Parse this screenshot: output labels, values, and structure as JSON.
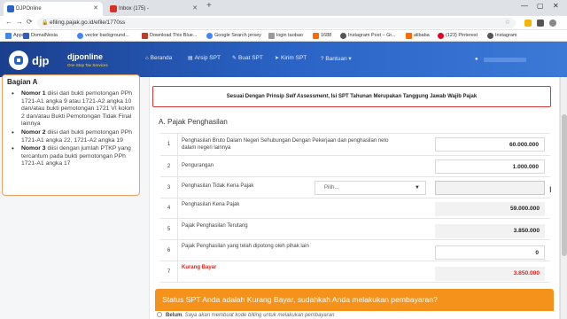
{
  "browser": {
    "tabs": [
      {
        "title": "DJPOnline",
        "active": true,
        "icon": "djp-favicon"
      },
      {
        "title": "Inbox (175) -",
        "active": false,
        "icon": "gmail-icon"
      }
    ],
    "url": "efiling.pajak.go.id/efile/1770ss",
    "bookmarks": [
      {
        "label": "Apps",
        "icon": "apps-icon",
        "color": "#4285f4"
      },
      {
        "label": "DomaiNesia",
        "icon": "domainesia-icon",
        "color": "#2f5fb8"
      },
      {
        "label": "vector background...",
        "icon": "google-icon",
        "color": "#4285f4"
      },
      {
        "label": "Download This Blue...",
        "icon": "page-icon",
        "color": "#c0392b"
      },
      {
        "label": "Google Search jersey",
        "icon": "google-icon",
        "color": "#4285f4"
      },
      {
        "label": "login taobao",
        "icon": "taobao-icon",
        "color": "#999999"
      },
      {
        "label": "1688",
        "icon": "1688-icon",
        "color": "#ff6a00"
      },
      {
        "label": "Instagram Post – Gr...",
        "icon": "instagram-icon",
        "color": "#555555"
      },
      {
        "label": "alibaba",
        "icon": "alibaba-icon",
        "color": "#ff6a00"
      },
      {
        "label": "(123) Pinterest",
        "icon": "pinterest-icon",
        "color": "#e60023"
      },
      {
        "label": "Instagram",
        "icon": "instagram-icon",
        "color": "#555555"
      }
    ]
  },
  "header": {
    "logo_text": "djp",
    "brand": "djponline",
    "tagline": "One Stop Tax Services",
    "nav": [
      {
        "label": "Beranda",
        "icon": "home-icon",
        "glyph": "⌂"
      },
      {
        "label": "Arsip SPT",
        "icon": "archive-icon",
        "glyph": "▤"
      },
      {
        "label": "Buat SPT",
        "icon": "edit-icon",
        "glyph": "✎"
      },
      {
        "label": "Kirim SPT",
        "icon": "send-icon",
        "glyph": "➤"
      },
      {
        "label": "Bantuan",
        "icon": "help-icon",
        "glyph": "?"
      }
    ],
    "user_icon": "user-icon"
  },
  "sidebar": {
    "title": "Bagian A",
    "items": [
      {
        "bold": "Nomor 1",
        "text": " diisi dari bukti pemotongan PPh 1721-A1 angka 9 atau 1721-A2 angka 10 dan/atau bukti pemotongan 1721 VI kolom 2 dan/atau Bukti Pemotongan Tidak Final lainnya"
      },
      {
        "bold": "Nomor 2",
        "text": " diisi dari bukti pemotongan PPh 1721-A1 angka 22, 1721-A2 angka 19"
      },
      {
        "bold": "Nomor 3",
        "text": " diisi dengan jumlah PTKP yang tercantum pada bukti pemotongan PPh 1721-A1 angka 17"
      }
    ]
  },
  "form": {
    "notice_prefix": "Sesuai Dengan Prinsip ",
    "notice_em": "Self Assessment",
    "notice_suffix": ", Isi SPT Tahunan Merupakan Tanggung Jawab Wajib Pajak",
    "section_title": "A. Pajak Penghasilan",
    "rows": [
      {
        "no": "1",
        "label": "Penghasilan Bruto Dalam Negeri Sehubungan Dengan Pekerjaan dan penghasilan neto dalam negeri lainnya",
        "value": "60.000.000",
        "kind": "input"
      },
      {
        "no": "2",
        "label": "Pengurangan",
        "value": "1.000.000",
        "kind": "input"
      },
      {
        "no": "3",
        "label": "Penghasilan Tidak Kena Pajak",
        "value": "",
        "kind": "readonly",
        "select_placeholder": "Pilih..."
      },
      {
        "no": "4",
        "label": "Penghasilan Kena Pajak",
        "value": "59.000.000",
        "kind": "readonly"
      },
      {
        "no": "5",
        "label": "Pajak Penghasilan Terutang",
        "value": "3.850.000",
        "kind": "readonly"
      },
      {
        "no": "6",
        "label": "Pajak Penghasilan yang telah dipotong oleh pihak lain",
        "value": "0",
        "kind": "input"
      },
      {
        "no": "7",
        "label": "Kurang Bayar",
        "value": "3.850.000",
        "kind": "readonly",
        "highlight": true
      }
    ],
    "payment_question": "Status SPT Anda adalah Kurang Bayar, sudahkah Anda melakukan pembayaran?",
    "payment_option_label": "Belum",
    "payment_option_text": ", Saya akan membuat kode billing untuk melakukan pembayaran"
  },
  "colors": {
    "header_dark": "#1a3f8e",
    "header_light": "#3c79d6",
    "banner_orange": "#f5921b",
    "alert_red": "#d9261c",
    "sidebar_border": "#f0a060"
  }
}
